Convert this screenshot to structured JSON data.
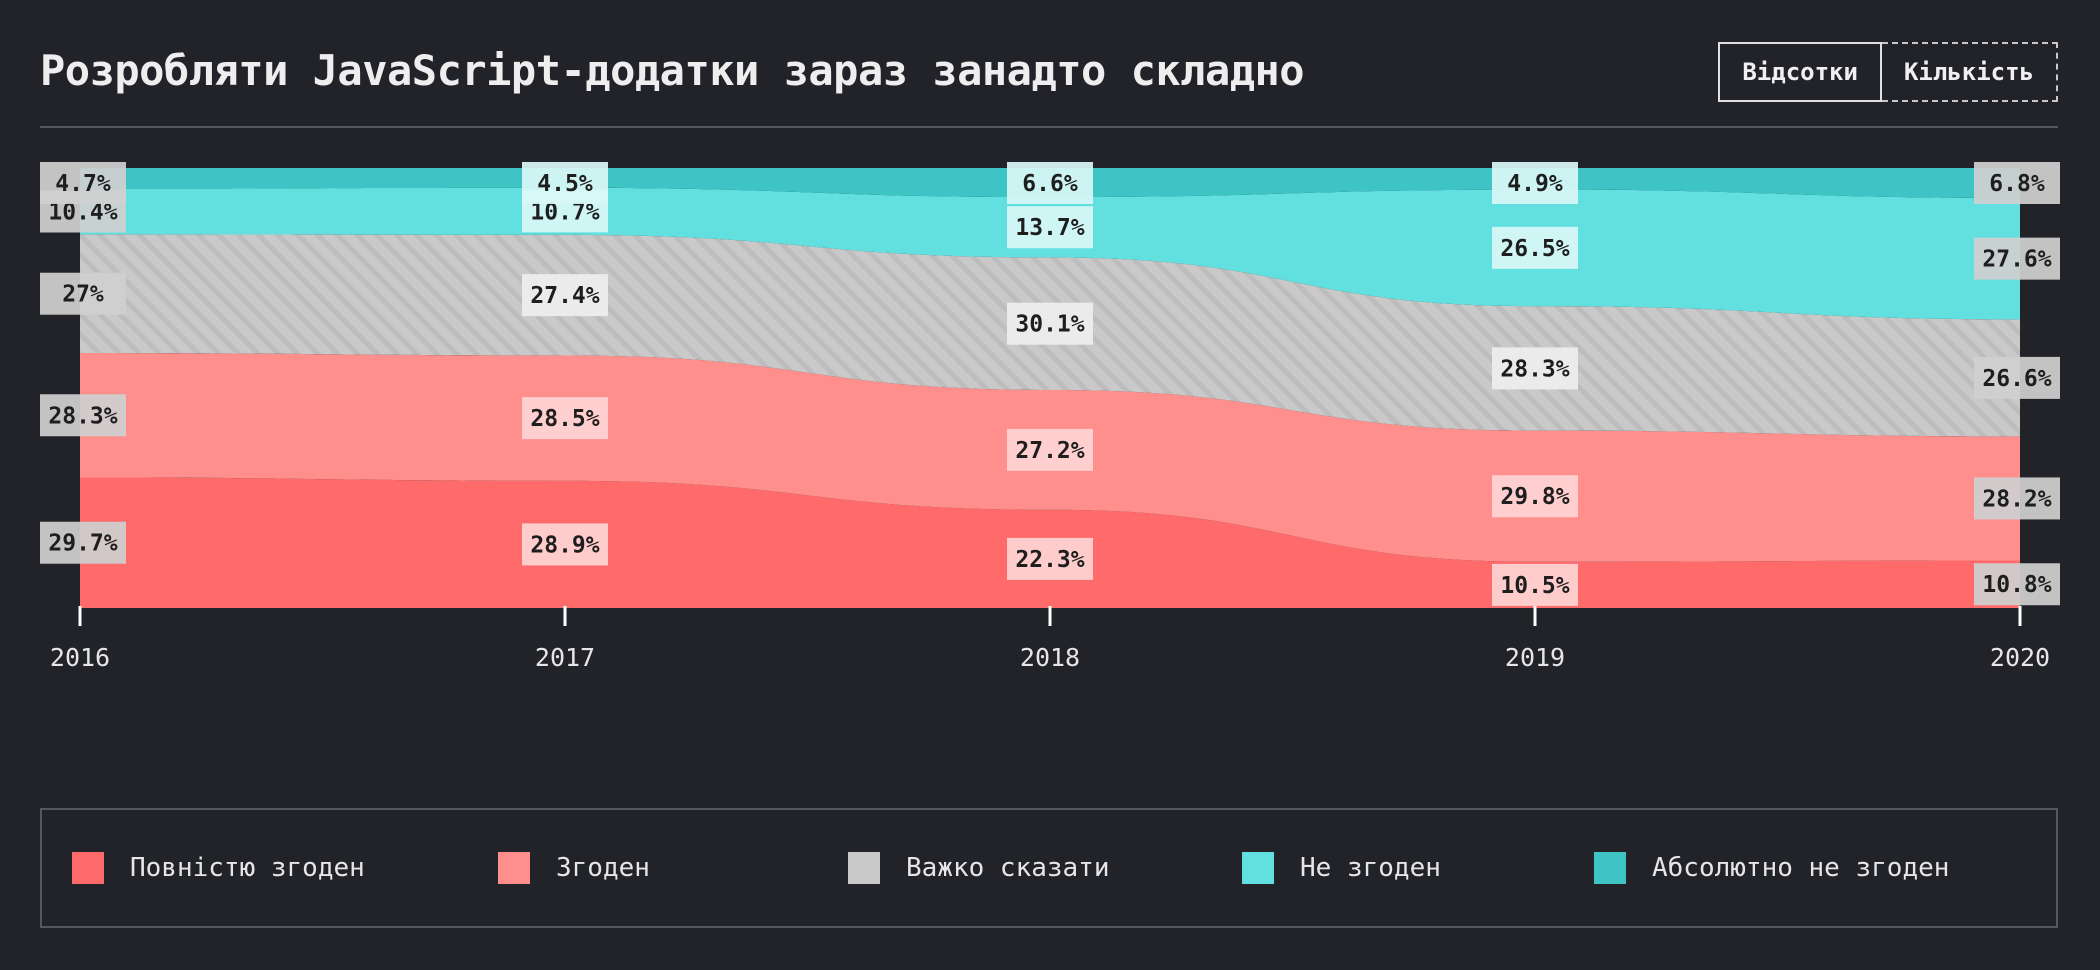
{
  "header": {
    "title": "Розробляти JavaScript-додатки зараз занадто складно"
  },
  "toggle": {
    "percent_label": "Відсотки",
    "count_label": "Кількість"
  },
  "colors": {
    "background": "#222328",
    "strongly_agree": "#ff6b6b",
    "agree": "#ff8f8c",
    "neutral": "#c9c9c9",
    "disagree": "#62e0e0",
    "strongly_disagree": "#3ec4c4"
  },
  "chart_data": {
    "type": "area",
    "stacked": true,
    "normalized_percent": true,
    "title": "Розробляти JavaScript-додатки зараз занадто складно",
    "x": [
      "2016",
      "2017",
      "2018",
      "2019",
      "2020"
    ],
    "ylim": [
      0,
      100
    ],
    "legend_position": "bottom",
    "series": [
      {
        "name": "Повністю згоден",
        "key": "strongly_agree",
        "values": [
          29.7,
          28.9,
          22.3,
          10.5,
          10.8
        ]
      },
      {
        "name": "Згоден",
        "key": "agree",
        "values": [
          28.3,
          28.5,
          27.2,
          29.8,
          28.2
        ]
      },
      {
        "name": "Важко сказати",
        "key": "neutral",
        "values": [
          27,
          27.4,
          30.1,
          28.3,
          26.6
        ]
      },
      {
        "name": "Не згоден",
        "key": "disagree",
        "values": [
          10.4,
          10.7,
          13.7,
          26.5,
          27.6
        ]
      },
      {
        "name": "Абсолютно не згоден",
        "key": "strongly_disagree",
        "values": [
          4.7,
          4.5,
          6.6,
          4.9,
          6.8
        ]
      }
    ]
  }
}
